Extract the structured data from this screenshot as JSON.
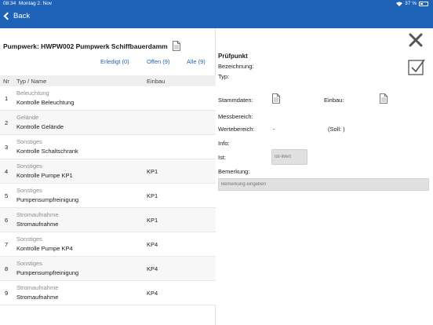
{
  "status": {
    "time": "08:34",
    "date": "Montag 2. Nov",
    "battery": "37 %"
  },
  "nav": {
    "back_label": "Back"
  },
  "header": {
    "title": "Pumpwerk: HWPW002 Pumpwerk Schiffbauerdamm"
  },
  "filters": {
    "done": "Erledigt (0)",
    "open": "Offen (9)",
    "all": "Alle (9)"
  },
  "table": {
    "columns": {
      "nr": "Nr",
      "typ": "Typ / Name",
      "einbau": "Einbau"
    },
    "rows": [
      {
        "nr": "1",
        "cat": "Beleuchtung",
        "name": "Kontrolle Beleuchtung",
        "einbau": ""
      },
      {
        "nr": "2",
        "cat": "Gelände",
        "name": "Kontrolle Gelände",
        "einbau": ""
      },
      {
        "nr": "3",
        "cat": "Sonstiges",
        "name": "Kontrolle Schaltschrank",
        "einbau": ""
      },
      {
        "nr": "4",
        "cat": "Sonstiges",
        "name": "Kontrolle Pumpe KP1",
        "einbau": "KP1"
      },
      {
        "nr": "5",
        "cat": "Sonstiges",
        "name": "Pumpensumpfreinigung",
        "einbau": "KP1"
      },
      {
        "nr": "6",
        "cat": "Stromaufnahme",
        "name": "Stromaufnahme",
        "einbau": "KP1"
      },
      {
        "nr": "7",
        "cat": "Sonstiges",
        "name": "Kontrolle Pumpe KP4",
        "einbau": "KP4"
      },
      {
        "nr": "8",
        "cat": "Sonstiges",
        "name": "Pumpensumpfreinigung",
        "einbau": "KP4"
      },
      {
        "nr": "9",
        "cat": "Stromaufnahme",
        "name": "Stromaufnahme",
        "einbau": "KP4"
      }
    ]
  },
  "detail": {
    "title": "Prüfpunkt",
    "bezeichnung": "Bezeichnung:",
    "typ": "Typ:",
    "stammdaten": "Stammdaten:",
    "einbau": "Einbau:",
    "messbereich": "Messbereich:",
    "wertebereich": "Wertebereich:",
    "wertebereich_value": "-",
    "soll": "(Soll: )",
    "info": "Info:",
    "ist": "Ist:",
    "ist_placeholder": "Ist-Wert",
    "bemerkung": "Bemerkung:",
    "bemerkung_placeholder": "Bemerkung eingeben"
  },
  "colors": {
    "accent": "#1f63b8",
    "header_bg": "#efefef"
  }
}
